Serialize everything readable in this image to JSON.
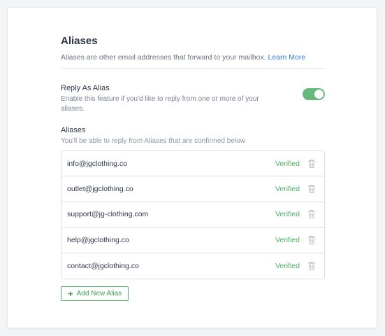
{
  "aliases_section": {
    "title": "Aliases",
    "description": "Aliases are other email addresses that forward to your mailbox.",
    "learn_more": "Learn More"
  },
  "reply_as_alias": {
    "title": "Reply As Alias",
    "description": "Enable this feature if you'd like to reply from one or more of your aliases.",
    "enabled": true
  },
  "aliases_list": {
    "title": "Aliases",
    "description": "You'll be able to reply from Aliases that are confirmed below",
    "items": [
      {
        "email": "info@jgclothing.co",
        "status": "Verified"
      },
      {
        "email": "outlet@jgclothing.co",
        "status": "Verified"
      },
      {
        "email": "support@jg-clothing.com",
        "status": "Verified"
      },
      {
        "email": "help@jgclothing.co",
        "status": "Verified"
      },
      {
        "email": "contact@jgclothing.co",
        "status": "Verified"
      }
    ]
  },
  "add_button": {
    "icon": "plus-icon",
    "label": "Add New Alias"
  },
  "colors": {
    "accent_green": "#4caf64",
    "toggle_green": "#67b97a",
    "link_blue": "#2f7dd0"
  }
}
